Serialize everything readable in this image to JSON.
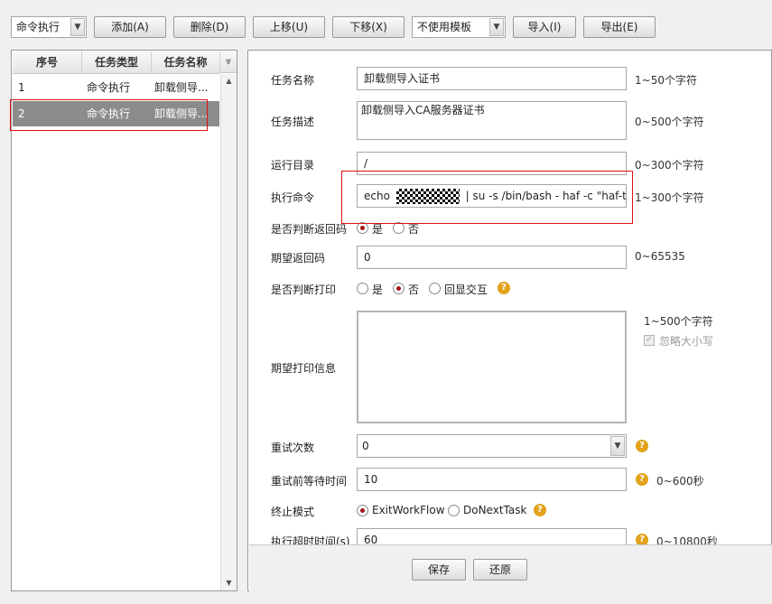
{
  "toolbar": {
    "type_select": "命令执行",
    "add": "添加(A)",
    "delete": "删除(D)",
    "move_up": "上移(U)",
    "move_down": "下移(X)",
    "template_select": "不使用模板",
    "import": "导入(I)",
    "export": "导出(E)"
  },
  "grid": {
    "columns": [
      "序号",
      "任务类型",
      "任务名称"
    ],
    "rows": [
      {
        "index": "1",
        "type": "命令执行",
        "name": "卸载侧导..."
      },
      {
        "index": "2",
        "type": "命令执行",
        "name": "卸载侧导..."
      }
    ],
    "selected_row": 2
  },
  "form": {
    "task_name": {
      "label": "任务名称",
      "value": "卸载侧导入证书",
      "hint": "1~50个字符"
    },
    "task_desc": {
      "label": "任务描述",
      "value": "卸载侧导入CA服务器证书",
      "hint": "0~500个字符"
    },
    "run_dir": {
      "label": "运行目录",
      "value": "/",
      "hint": "0~300个字符"
    },
    "command": {
      "label": "执行命令",
      "prefix": "echo",
      "value": "| su -s /bin/bash - haf -c \"haf-tool ce",
      "hint": "1~300个字符"
    },
    "check_return": {
      "label": "是否判断返回码",
      "options": [
        "是",
        "否"
      ],
      "selected": "是"
    },
    "expected_return": {
      "label": "期望返回码",
      "value": "0",
      "hint": "0~65535"
    },
    "check_print": {
      "label": "是否判断打印",
      "options": [
        "是",
        "否",
        "回显交互"
      ],
      "selected": "否"
    },
    "expected_print": {
      "label": "期望打印信息",
      "value": "",
      "hint": "1~500个字符",
      "ignore_case": "忽略大小写"
    },
    "retry_count": {
      "label": "重试次数",
      "value": "0"
    },
    "retry_wait": {
      "label": "重试前等待时间",
      "value": "10",
      "hint": "0~600秒"
    },
    "stop_mode": {
      "label": "终止模式",
      "options": [
        "ExitWorkFlow",
        "DoNextTask"
      ],
      "selected": "ExitWorkFlow"
    },
    "timeout": {
      "label": "执行超时时间(s)",
      "value": "60",
      "hint": "0~10800秒"
    }
  },
  "footer": {
    "save": "保存",
    "restore": "还原"
  },
  "colors": {
    "accent": "#a31414",
    "selected_row": "#8c8c8c",
    "highlight_box": "#dd1111",
    "help": "#e2a21a"
  }
}
